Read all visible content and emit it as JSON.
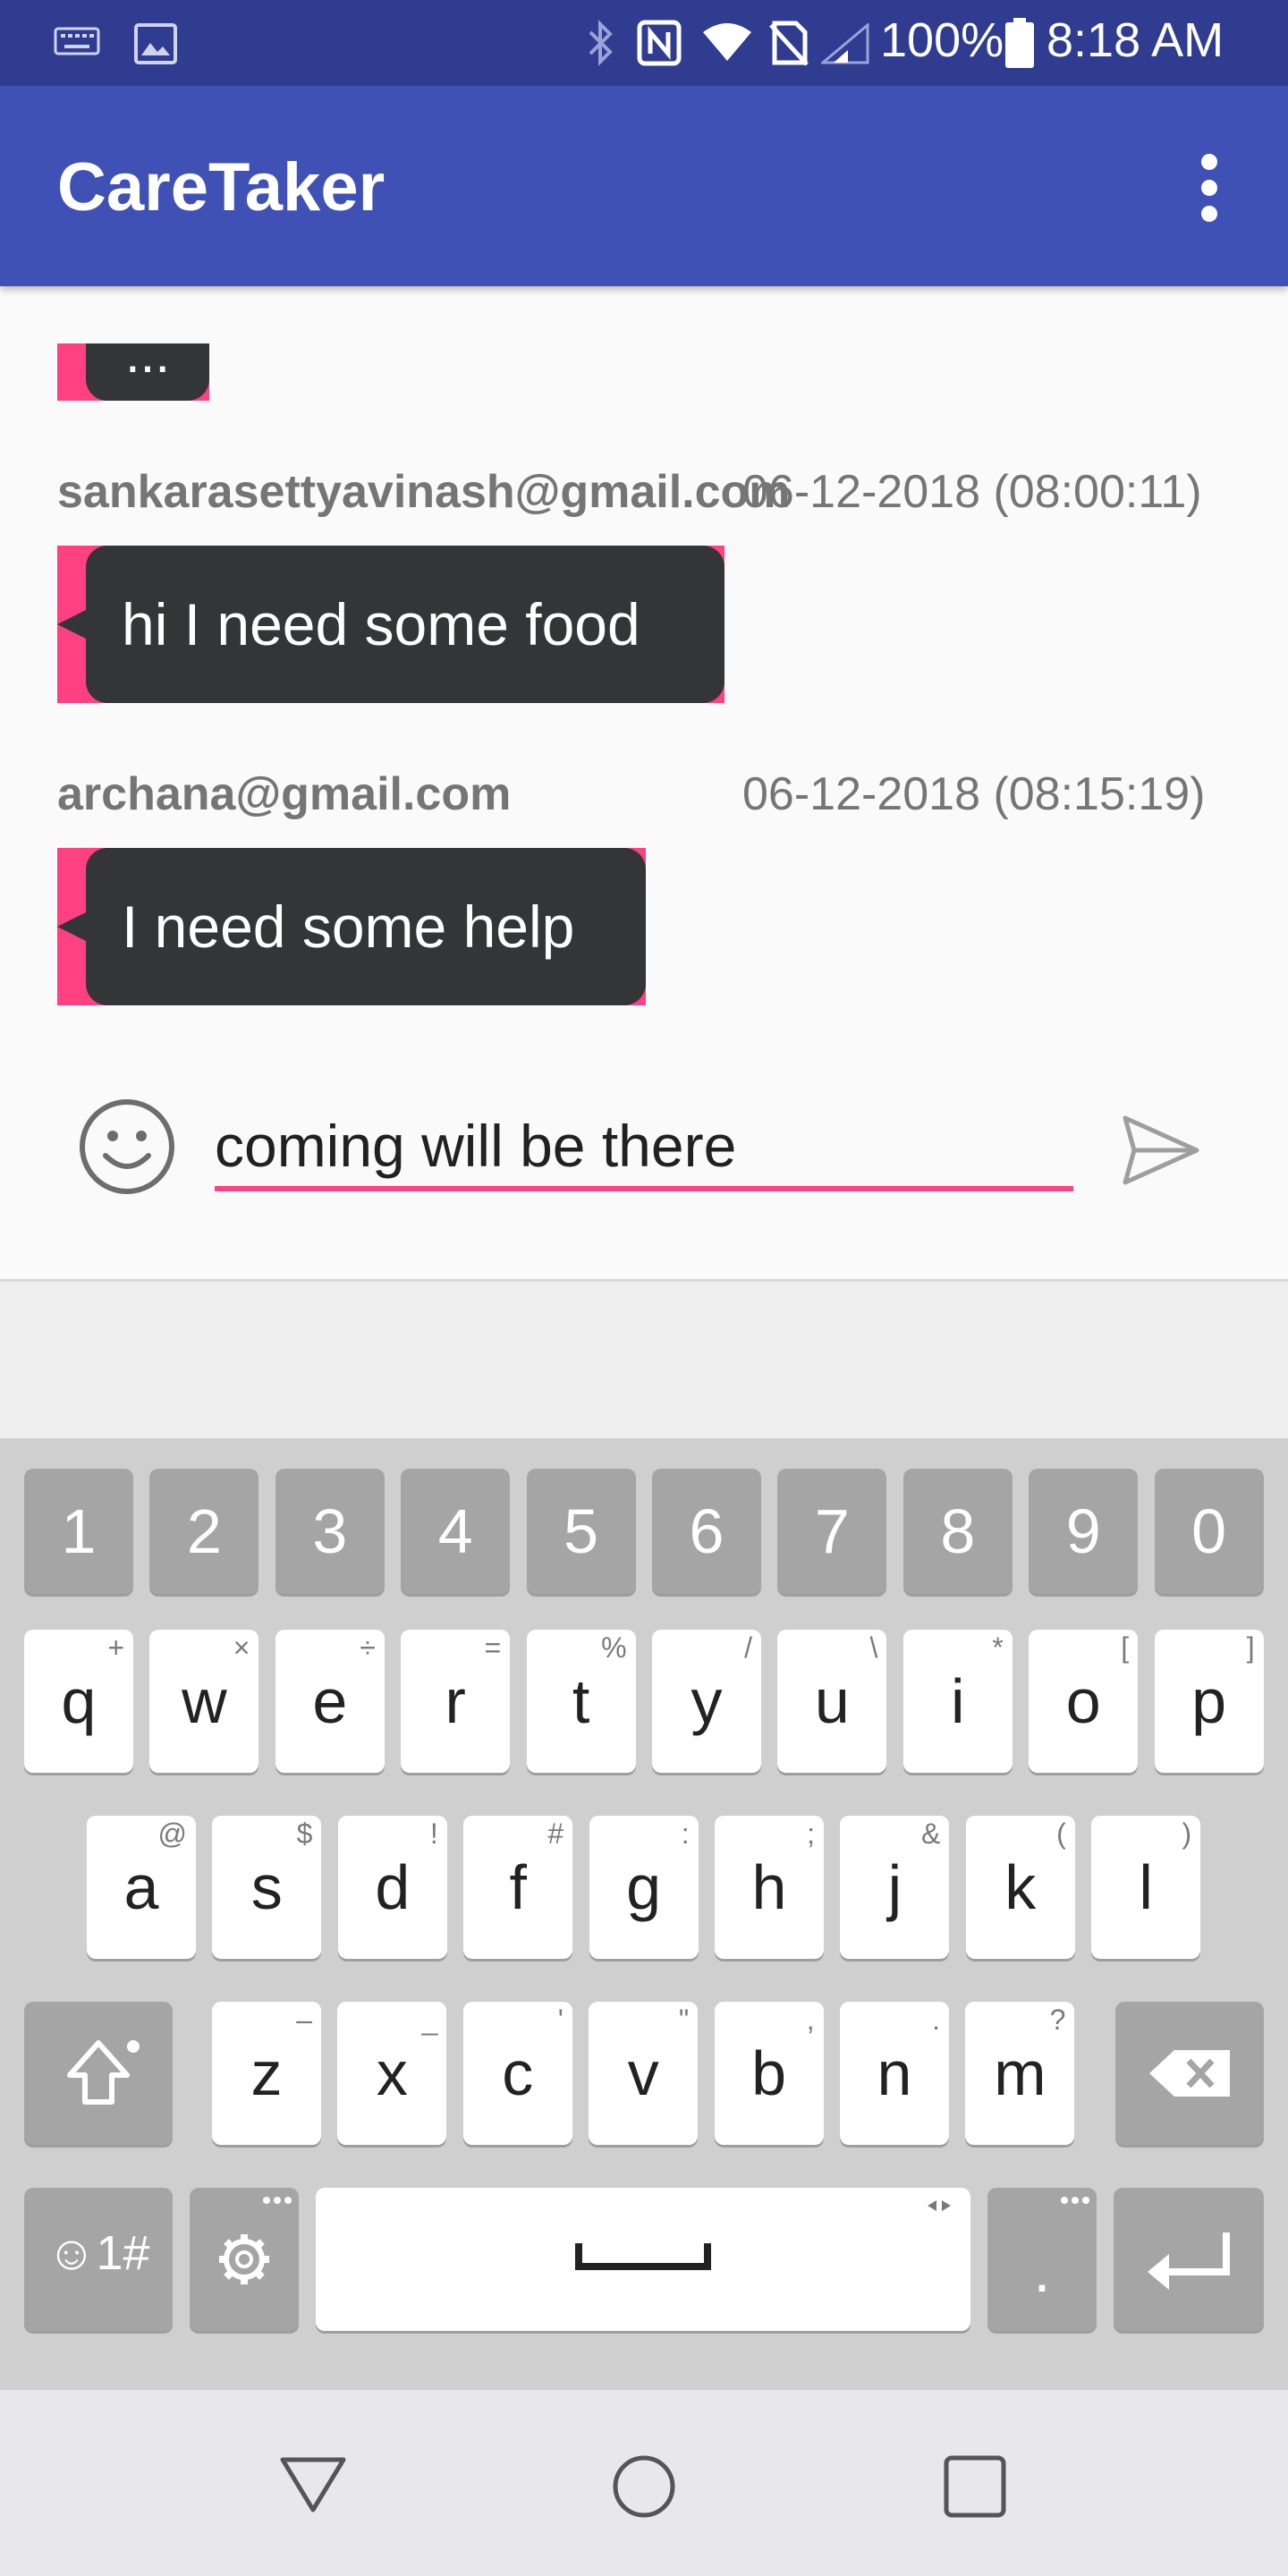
{
  "status_bar": {
    "battery": "100%",
    "time": "8:18 AM"
  },
  "app_bar": {
    "title": "CareTaker"
  },
  "messages": [
    {
      "sender": "sankarasettyavinash@gmail.com",
      "timestamp": "06-12-2018 (08:00:11)",
      "text": "hi I need some food"
    },
    {
      "sender": "archana@gmail.com",
      "timestamp": "06-12-2018 (08:15:19)",
      "text": "I need some help"
    }
  ],
  "partial_bubble_text": "...",
  "composer": {
    "value": "coming will be there"
  },
  "keyboard": {
    "number_row": [
      "1",
      "2",
      "3",
      "4",
      "5",
      "6",
      "7",
      "8",
      "9",
      "0"
    ],
    "row1": [
      {
        "key": "q",
        "hint": "+"
      },
      {
        "key": "w",
        "hint": "×"
      },
      {
        "key": "e",
        "hint": "÷"
      },
      {
        "key": "r",
        "hint": "="
      },
      {
        "key": "t",
        "hint": "%"
      },
      {
        "key": "y",
        "hint": "/"
      },
      {
        "key": "u",
        "hint": "\\"
      },
      {
        "key": "i",
        "hint": "*"
      },
      {
        "key": "o",
        "hint": "["
      },
      {
        "key": "p",
        "hint": "]"
      }
    ],
    "row2": [
      {
        "key": "a",
        "hint": "@"
      },
      {
        "key": "s",
        "hint": "$"
      },
      {
        "key": "d",
        "hint": "!"
      },
      {
        "key": "f",
        "hint": "#"
      },
      {
        "key": "g",
        "hint": ":"
      },
      {
        "key": "h",
        "hint": ";"
      },
      {
        "key": "j",
        "hint": "&"
      },
      {
        "key": "k",
        "hint": "("
      },
      {
        "key": "l",
        "hint": ")"
      }
    ],
    "row3": [
      {
        "key": "z",
        "hint": "–"
      },
      {
        "key": "x",
        "hint": "_"
      },
      {
        "key": "c",
        "hint": "'"
      },
      {
        "key": "v",
        "hint": "\""
      },
      {
        "key": "b",
        "hint": ","
      },
      {
        "key": "n",
        "hint": "."
      },
      {
        "key": "m",
        "hint": "?"
      }
    ],
    "symbols_label": "☺1#",
    "period_label": "."
  },
  "colors": {
    "app_bar": "#3f51b5",
    "status_bar": "#2f3c8f",
    "accent": "#ff4081",
    "bubble": "#333537"
  },
  "icons": {
    "status": [
      "keyboard-icon",
      "image-icon",
      "bluetooth-icon",
      "nfc-icon",
      "wifi-icon",
      "no-sim-icon",
      "signal-icon",
      "battery-icon"
    ],
    "nav": [
      "back-icon",
      "home-icon",
      "recents-icon"
    ]
  }
}
